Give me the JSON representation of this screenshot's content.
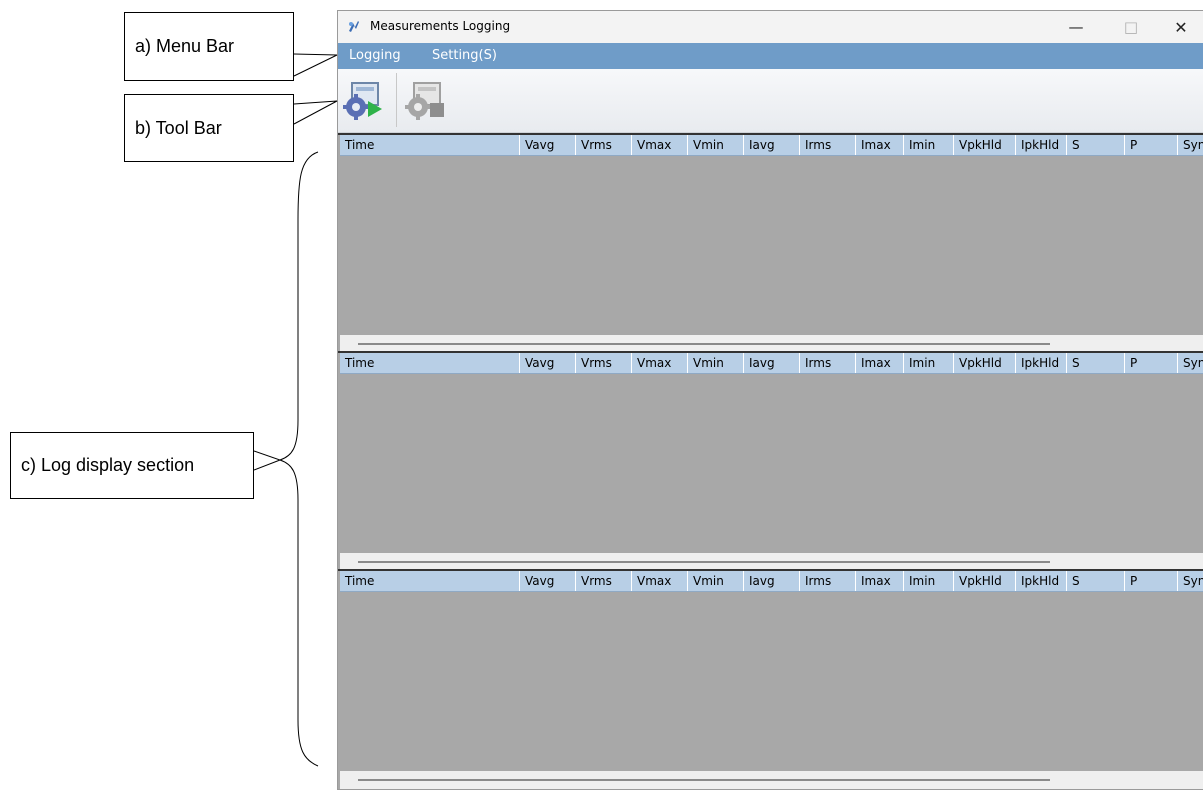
{
  "callouts": {
    "menu_bar": "a) Menu Bar",
    "tool_bar": "b) Tool Bar",
    "log_display": "c) Log display section"
  },
  "window": {
    "title": "Measurements Logging",
    "controls": {
      "minimize": "—",
      "maximize": "□",
      "close": "✕"
    }
  },
  "menu": {
    "logging": "Logging",
    "settings": "Setting(S)"
  },
  "toolbar": {
    "start_icon": "gear-play-icon",
    "stop_icon": "gear-stop-icon"
  },
  "columns": [
    "Time",
    "Vavg",
    "Vrms",
    "Vmax",
    "Vmin",
    "Iavg",
    "Irms",
    "Imax",
    "Imin",
    "VpkHld",
    "IpkHld",
    "S",
    "P",
    "Syn"
  ],
  "colors": {
    "menu_bar": "#6f9cc8",
    "header": "#b8cfe6",
    "grid_bg": "#a8a8a8"
  }
}
